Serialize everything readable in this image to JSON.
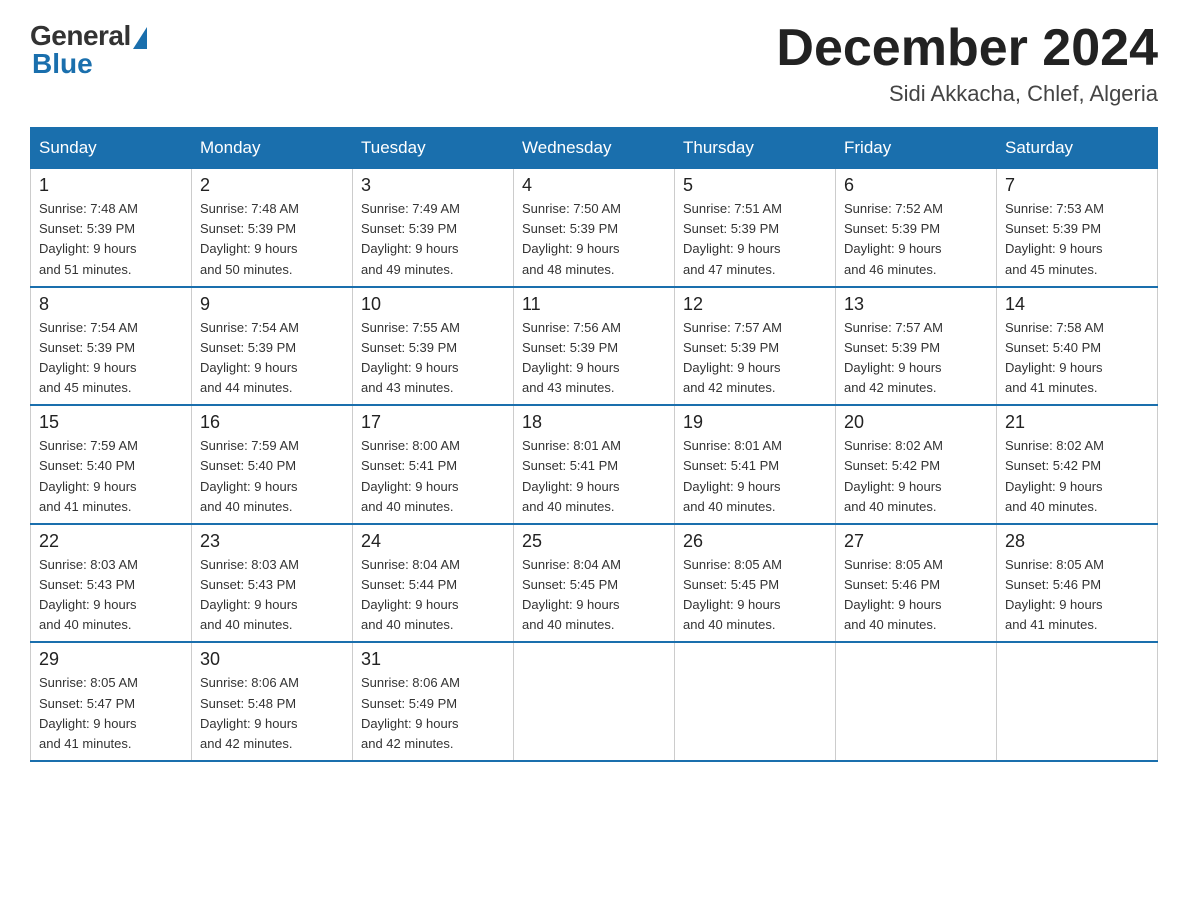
{
  "logo": {
    "general": "General",
    "blue": "Blue"
  },
  "header": {
    "month_year": "December 2024",
    "location": "Sidi Akkacha, Chlef, Algeria"
  },
  "days_of_week": [
    "Sunday",
    "Monday",
    "Tuesday",
    "Wednesday",
    "Thursday",
    "Friday",
    "Saturday"
  ],
  "weeks": [
    [
      {
        "day": "1",
        "sunrise": "7:48 AM",
        "sunset": "5:39 PM",
        "daylight": "9 hours and 51 minutes."
      },
      {
        "day": "2",
        "sunrise": "7:48 AM",
        "sunset": "5:39 PM",
        "daylight": "9 hours and 50 minutes."
      },
      {
        "day": "3",
        "sunrise": "7:49 AM",
        "sunset": "5:39 PM",
        "daylight": "9 hours and 49 minutes."
      },
      {
        "day": "4",
        "sunrise": "7:50 AM",
        "sunset": "5:39 PM",
        "daylight": "9 hours and 48 minutes."
      },
      {
        "day": "5",
        "sunrise": "7:51 AM",
        "sunset": "5:39 PM",
        "daylight": "9 hours and 47 minutes."
      },
      {
        "day": "6",
        "sunrise": "7:52 AM",
        "sunset": "5:39 PM",
        "daylight": "9 hours and 46 minutes."
      },
      {
        "day": "7",
        "sunrise": "7:53 AM",
        "sunset": "5:39 PM",
        "daylight": "9 hours and 45 minutes."
      }
    ],
    [
      {
        "day": "8",
        "sunrise": "7:54 AM",
        "sunset": "5:39 PM",
        "daylight": "9 hours and 45 minutes."
      },
      {
        "day": "9",
        "sunrise": "7:54 AM",
        "sunset": "5:39 PM",
        "daylight": "9 hours and 44 minutes."
      },
      {
        "day": "10",
        "sunrise": "7:55 AM",
        "sunset": "5:39 PM",
        "daylight": "9 hours and 43 minutes."
      },
      {
        "day": "11",
        "sunrise": "7:56 AM",
        "sunset": "5:39 PM",
        "daylight": "9 hours and 43 minutes."
      },
      {
        "day": "12",
        "sunrise": "7:57 AM",
        "sunset": "5:39 PM",
        "daylight": "9 hours and 42 minutes."
      },
      {
        "day": "13",
        "sunrise": "7:57 AM",
        "sunset": "5:39 PM",
        "daylight": "9 hours and 42 minutes."
      },
      {
        "day": "14",
        "sunrise": "7:58 AM",
        "sunset": "5:40 PM",
        "daylight": "9 hours and 41 minutes."
      }
    ],
    [
      {
        "day": "15",
        "sunrise": "7:59 AM",
        "sunset": "5:40 PM",
        "daylight": "9 hours and 41 minutes."
      },
      {
        "day": "16",
        "sunrise": "7:59 AM",
        "sunset": "5:40 PM",
        "daylight": "9 hours and 40 minutes."
      },
      {
        "day": "17",
        "sunrise": "8:00 AM",
        "sunset": "5:41 PM",
        "daylight": "9 hours and 40 minutes."
      },
      {
        "day": "18",
        "sunrise": "8:01 AM",
        "sunset": "5:41 PM",
        "daylight": "9 hours and 40 minutes."
      },
      {
        "day": "19",
        "sunrise": "8:01 AM",
        "sunset": "5:41 PM",
        "daylight": "9 hours and 40 minutes."
      },
      {
        "day": "20",
        "sunrise": "8:02 AM",
        "sunset": "5:42 PM",
        "daylight": "9 hours and 40 minutes."
      },
      {
        "day": "21",
        "sunrise": "8:02 AM",
        "sunset": "5:42 PM",
        "daylight": "9 hours and 40 minutes."
      }
    ],
    [
      {
        "day": "22",
        "sunrise": "8:03 AM",
        "sunset": "5:43 PM",
        "daylight": "9 hours and 40 minutes."
      },
      {
        "day": "23",
        "sunrise": "8:03 AM",
        "sunset": "5:43 PM",
        "daylight": "9 hours and 40 minutes."
      },
      {
        "day": "24",
        "sunrise": "8:04 AM",
        "sunset": "5:44 PM",
        "daylight": "9 hours and 40 minutes."
      },
      {
        "day": "25",
        "sunrise": "8:04 AM",
        "sunset": "5:45 PM",
        "daylight": "9 hours and 40 minutes."
      },
      {
        "day": "26",
        "sunrise": "8:05 AM",
        "sunset": "5:45 PM",
        "daylight": "9 hours and 40 minutes."
      },
      {
        "day": "27",
        "sunrise": "8:05 AM",
        "sunset": "5:46 PM",
        "daylight": "9 hours and 40 minutes."
      },
      {
        "day": "28",
        "sunrise": "8:05 AM",
        "sunset": "5:46 PM",
        "daylight": "9 hours and 41 minutes."
      }
    ],
    [
      {
        "day": "29",
        "sunrise": "8:05 AM",
        "sunset": "5:47 PM",
        "daylight": "9 hours and 41 minutes."
      },
      {
        "day": "30",
        "sunrise": "8:06 AM",
        "sunset": "5:48 PM",
        "daylight": "9 hours and 42 minutes."
      },
      {
        "day": "31",
        "sunrise": "8:06 AM",
        "sunset": "5:49 PM",
        "daylight": "9 hours and 42 minutes."
      },
      null,
      null,
      null,
      null
    ]
  ]
}
